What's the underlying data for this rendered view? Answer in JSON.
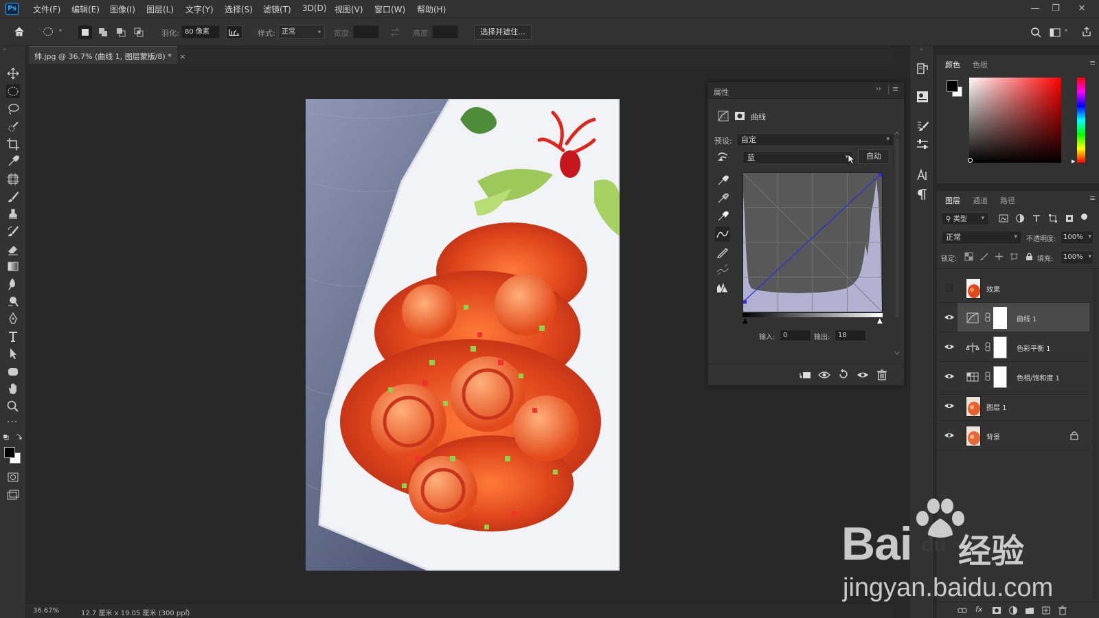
{
  "app": {
    "logo": "Ps"
  },
  "menu": [
    "文件(F)",
    "编辑(E)",
    "图像(I)",
    "图层(L)",
    "文字(Y)",
    "选择(S)",
    "滤镜(T)",
    "3D(D)",
    "视图(V)",
    "窗口(W)",
    "帮助(H)"
  ],
  "window_controls": {
    "minimize": "—",
    "restore": "❐",
    "close": "✕"
  },
  "options": {
    "feather_label": "羽化:",
    "feather_value": "80 像素",
    "style_label": "样式:",
    "style_value": "正常",
    "width_label": "宽度:",
    "height_label": "高度:",
    "select_mask_button": "选择并遮住..."
  },
  "document": {
    "tab_title": "帅.jpg @ 36.7% (曲线 1, 图层蒙版/8) *",
    "tab_close": "×",
    "zoom": "36.67%",
    "size_info": "12.7 厘米 x 19.05 厘米 (300 ppi)",
    "status_arrow": "›"
  },
  "properties": {
    "title": "属性",
    "adjustment_name": "曲线",
    "preset_label": "预设:",
    "preset_value": "自定",
    "channel_value": "蓝",
    "auto_button": "自动",
    "input_label": "输入:",
    "input_value": "0",
    "output_label": "输出:",
    "output_value": "18",
    "curve_points": [
      [
        0,
        18
      ],
      [
        255,
        255
      ]
    ],
    "curve_color": "#2f2fd8"
  },
  "color_panel": {
    "tabs": [
      "颜色",
      "色板"
    ],
    "foreground": "#000000",
    "background": "#ffffff",
    "hue": "#ff0000"
  },
  "layers_panel": {
    "tabs": [
      "图层",
      "通道",
      "路径"
    ],
    "filter_label": "类型",
    "blend_mode": "正常",
    "opacity_label": "不透明度:",
    "opacity_value": "100%",
    "lock_label": "锁定:",
    "fill_label": "填充:",
    "fill_value": "100%",
    "layers": [
      {
        "name": "效果",
        "visible": false,
        "kind": "image",
        "selected": false
      },
      {
        "name": "曲线 1",
        "visible": true,
        "kind": "curves",
        "selected": true
      },
      {
        "name": "色彩平衡 1",
        "visible": true,
        "kind": "balance",
        "selected": false
      },
      {
        "name": "色相/饱和度 1",
        "visible": true,
        "kind": "hue",
        "selected": false
      },
      {
        "name": "图层 1",
        "visible": true,
        "kind": "image",
        "selected": false
      },
      {
        "name": "背景",
        "visible": true,
        "kind": "image",
        "selected": false,
        "locked": true
      }
    ]
  },
  "watermark": {
    "brand": "Bai",
    "brand_cn": "经验",
    "url": "jingyan.baidu.com"
  }
}
